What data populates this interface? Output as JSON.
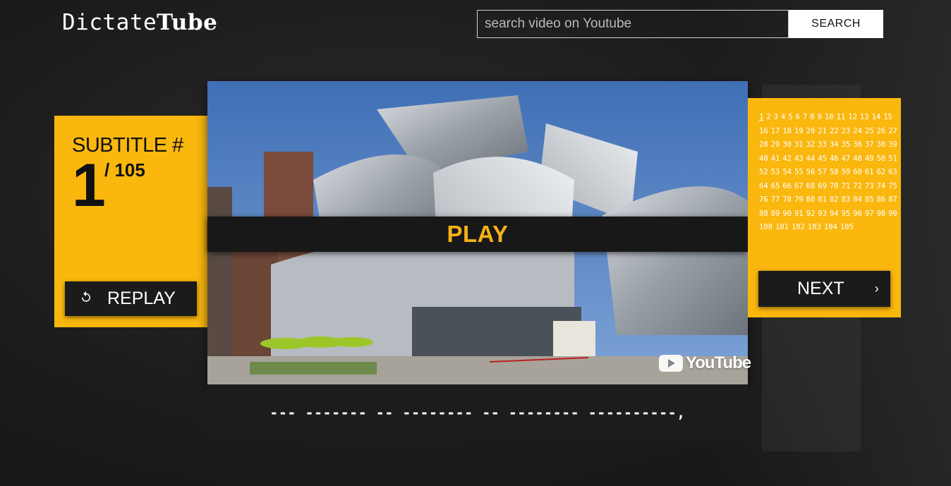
{
  "app": {
    "logo_prefix": "Dictate",
    "logo_suffix": "Tube"
  },
  "search": {
    "placeholder": "search video on Youtube",
    "value": "",
    "button_label": "SEARCH"
  },
  "subtitle": {
    "label": "SUBTITLE #",
    "current": "1",
    "total": "/ 105"
  },
  "controls": {
    "replay_label": "REPLAY",
    "replay_icon": "replay-icon",
    "play_label": "PLAY",
    "next_label": "NEXT",
    "next_icon": "chevron-right-icon"
  },
  "video": {
    "watermark": "YouTube"
  },
  "caption": {
    "masked_text": "--- ------- -- -------- -- -------- ----------,"
  },
  "subtitle_numbers": [
    "1",
    "2",
    "3",
    "4",
    "5",
    "6",
    "7",
    "8",
    "9",
    "10",
    "11",
    "12",
    "13",
    "14",
    "15",
    "16",
    "17",
    "18",
    "19",
    "20",
    "21",
    "22",
    "23",
    "24",
    "25",
    "26",
    "27",
    "28",
    "29",
    "30",
    "31",
    "32",
    "33",
    "34",
    "35",
    "36",
    "37",
    "38",
    "39",
    "40",
    "41",
    "42",
    "43",
    "44",
    "45",
    "46",
    "47",
    "48",
    "49",
    "50",
    "51",
    "52",
    "53",
    "54",
    "55",
    "56",
    "57",
    "58",
    "59",
    "60",
    "61",
    "62",
    "63",
    "64",
    "65",
    "66",
    "67",
    "68",
    "69",
    "70",
    "71",
    "72",
    "73",
    "74",
    "75",
    "76",
    "77",
    "78",
    "79",
    "80",
    "81",
    "82",
    "83",
    "84",
    "85",
    "86",
    "87",
    "88",
    "89",
    "90",
    "91",
    "92",
    "93",
    "94",
    "95",
    "96",
    "97",
    "98",
    "99",
    "100",
    "101",
    "102",
    "103",
    "104",
    "105"
  ],
  "active_subtitle": "1",
  "colors": {
    "accent": "#fab70e",
    "play_text": "#f4b214",
    "button_bg": "#1b1b1b"
  }
}
